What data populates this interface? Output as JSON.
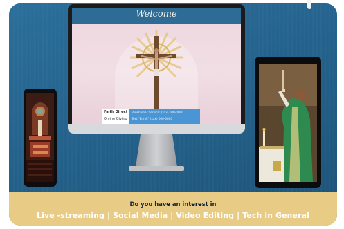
{
  "screen": {
    "header_title": "Welcome",
    "info_name": "Faith Direct",
    "info_sub": "Online Giving",
    "info_line1": "Parishioner Service: (xxx) 000-0000",
    "info_line2": "Text \"Enroll\" (xxx) 000-0000"
  },
  "banner": {
    "question": "Do you have an interest in",
    "topics": "Live -streaming  |  Social Media  |  Video Editing  |  Tech in General"
  },
  "colors": {
    "background_blue": "#24628c",
    "banner_gold": "#e8cc86",
    "screen_header": "#2e6c95"
  }
}
